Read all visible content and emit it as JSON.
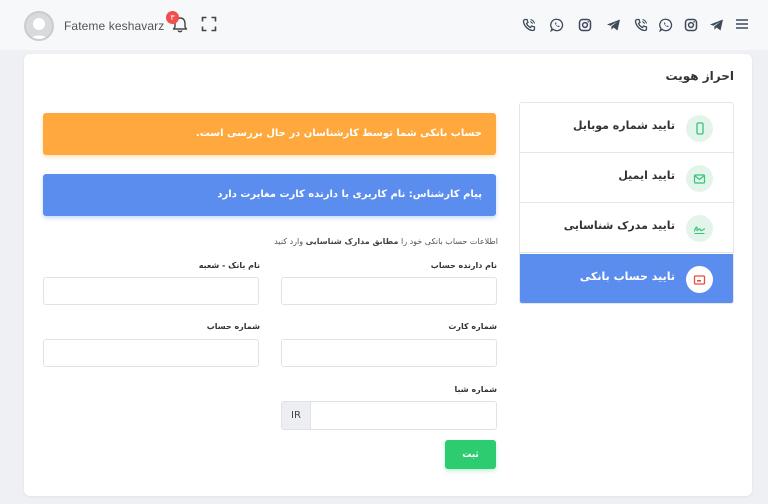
{
  "header": {
    "user_name": "Fateme keshavarz",
    "notification_count": "۳",
    "social_icons": [
      "phone-icon",
      "whatsapp-icon",
      "instagram-icon",
      "telegram-icon",
      "phone-icon",
      "whatsapp-icon",
      "instagram-icon",
      "telegram-icon"
    ],
    "menu_icon": "hamburger-icon"
  },
  "page": {
    "title": "احراز هویت"
  },
  "steps": [
    {
      "label": "تایید شماره موبایل",
      "icon": "mobile-icon",
      "active": false
    },
    {
      "label": "تایید ایمیل",
      "icon": "email-icon",
      "active": false
    },
    {
      "label": "تایید مدرک شناسایی",
      "icon": "signature-icon",
      "active": false
    },
    {
      "label": "تایید حساب بانکی",
      "icon": "bank-card-icon",
      "active": true
    }
  ],
  "alerts": {
    "review": "حساب بانکی شما توسط کارشناسان در حال بررسی است.",
    "expert": "پیام کارشناس: نام کاربری با دارنده کارت مغایرت دارد"
  },
  "form": {
    "intro_prefix": "اطلاعات حساب بانکی خود را",
    "intro_bold": "مطابق مدارک شناسایی",
    "intro_suffix": "وارد کنید",
    "holder_label": "نام دارنده حساب",
    "bank_label": "نام بانک - شعبه",
    "card_label": "شماره کارت",
    "account_label": "شماره حساب",
    "sheba_label": "شماره شبا",
    "sheba_prefix": "IR",
    "holder_value": "",
    "bank_value": "",
    "card_value": "",
    "account_value": "",
    "sheba_value": "",
    "submit_label": "ثبت"
  },
  "colors": {
    "accent_blue": "#5b8def",
    "warning_orange": "#ffa83d",
    "success_green": "#2ecc71",
    "badge_red": "#f34d4d"
  }
}
